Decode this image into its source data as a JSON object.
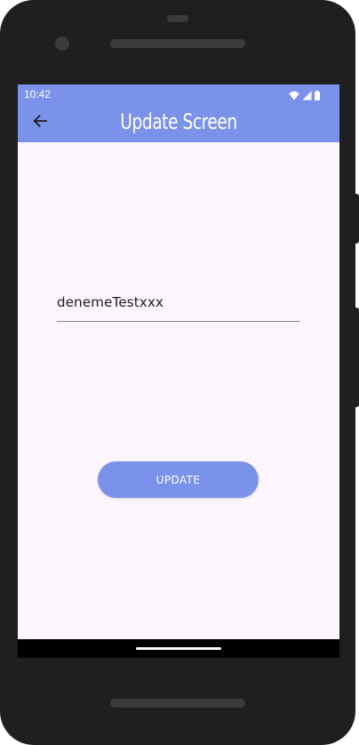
{
  "status_bar": {
    "time": "10:42",
    "icons": [
      "wifi-icon",
      "signal-icon",
      "battery-icon"
    ]
  },
  "app_bar": {
    "title": "Update Screen",
    "back_icon": "arrow-back-icon",
    "color": "#7b92ea"
  },
  "form": {
    "input_value": "denemeTestxxx",
    "update_button_label": "UPDATE"
  },
  "colors": {
    "accent": "#7b92ea",
    "background": "#fcf5fc",
    "device": "#1f1f1f"
  }
}
